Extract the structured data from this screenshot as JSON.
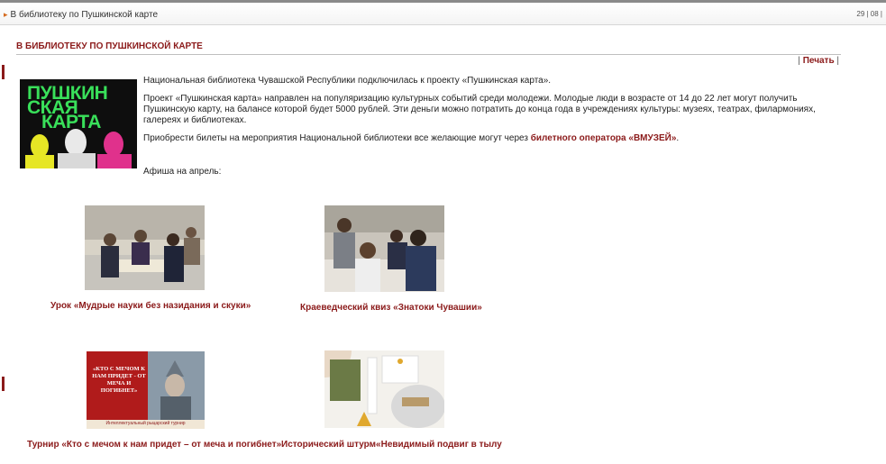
{
  "breadcrumb": {
    "current": "В библиотеку по Пушкинской карте"
  },
  "header_date": "29 | 08 |",
  "page": {
    "title": "В БИБЛИОТЕКУ ПО ПУШКИНСКОЙ КАРТЕ",
    "print_label": "Печать",
    "hero_logo_lines": [
      "ПУШКИН",
      "СКАЯ",
      "КАРТА"
    ],
    "paragraphs": [
      "Национальная библиотека Чувашской Республики подключилась к проекту «Пушкинская карта».",
      "Проект «Пушкинская карта» направлен на популяризацию культурных событий среди молодежи. Молодые люди в возрасте от 14 до 22 лет могут получить Пушкинскую карту, на балансе которой будет 5000 рублей. Эти деньги можно потратить до конца года в учреждениях культуры: музеях, театрах, филармониях, галереях и библиотеках."
    ],
    "tickets_text": "Приобрести билеты на мероприятия Национальной библиотеки все желающие могут через ",
    "tickets_link": "билетного оператора «ВМУЗЕЙ»",
    "tickets_end": ".",
    "afisha_label": "Афиша на апрель:"
  },
  "events": [
    {
      "caption": "Урок «Мудрые науки без назидания и скуки»"
    },
    {
      "caption": "Краеведческий квиз «Знатоки Чувашии»"
    },
    {
      "caption": "Турнир «Кто с мечом к нам придет – от меча и погибнет»",
      "poster_text": "«КТО С МЕЧОМ К НАМ ПРИДЕТ - ОТ МЕЧА И ПОГИБНЕТ»",
      "poster_sub": "Интеллектуальный рыцарский турнир"
    },
    {
      "caption": "Исторический штурм«Невидимый подвиг в тылу"
    }
  ]
}
